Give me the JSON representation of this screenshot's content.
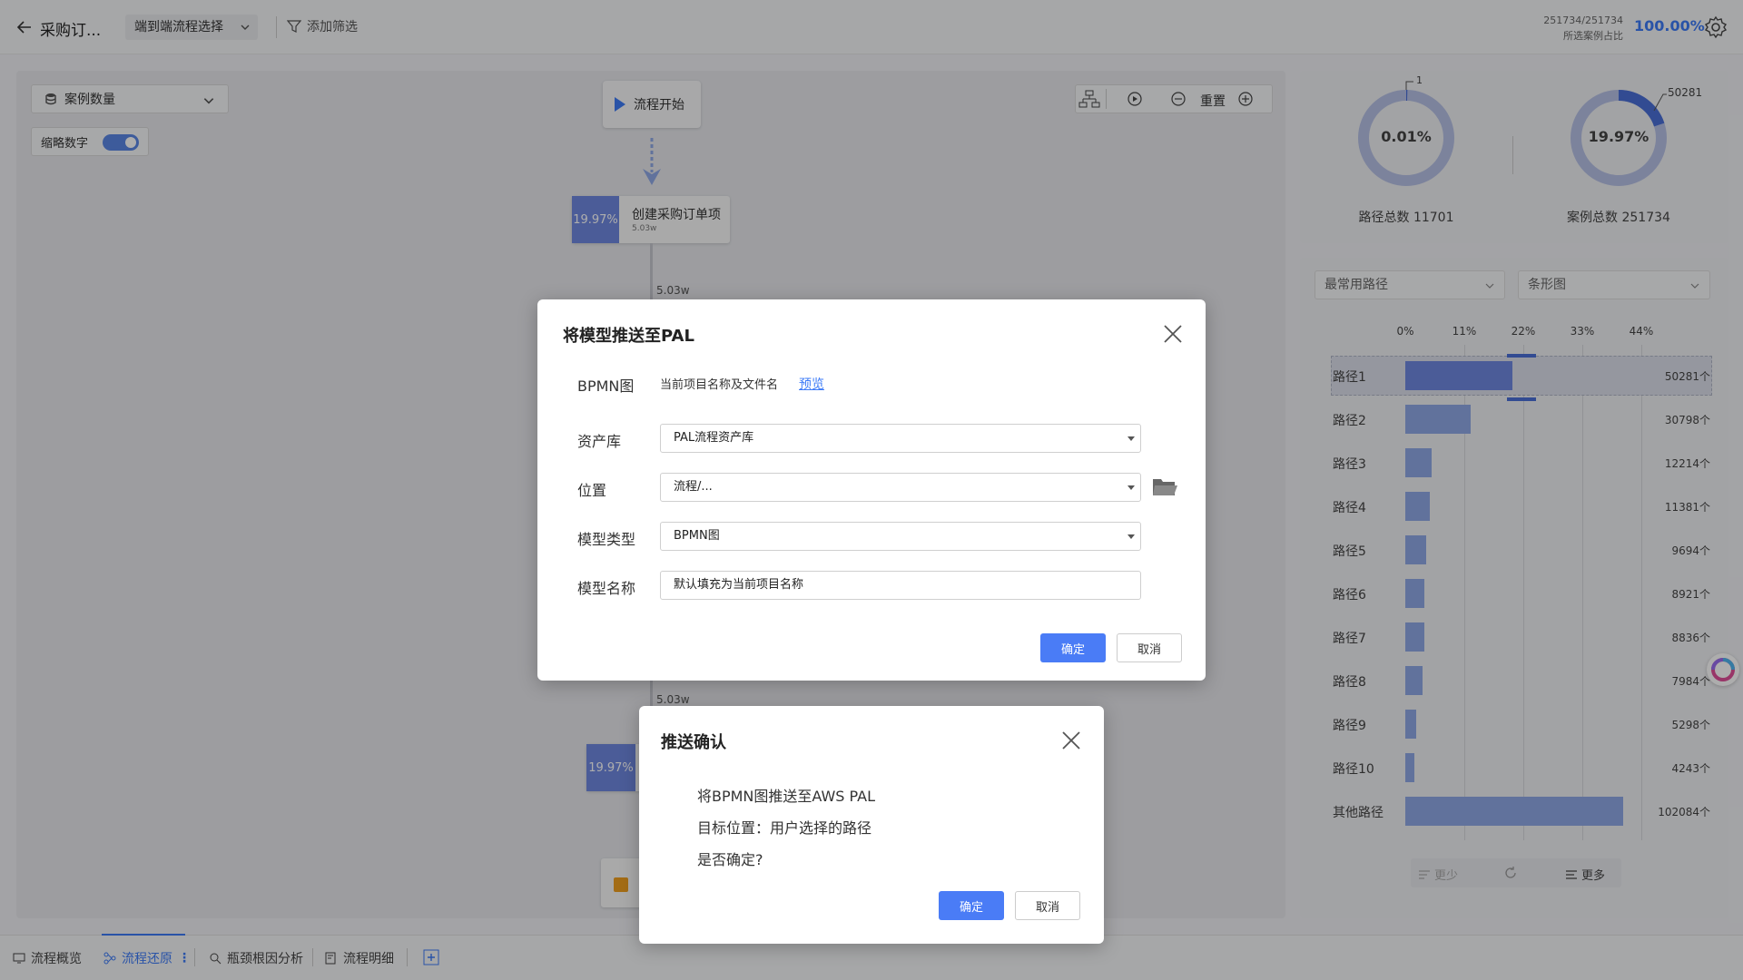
{
  "topbar": {
    "title": "采购订...",
    "flow_select": "端到端流程选择",
    "add_filter": "添加筛选",
    "ratio": "251734/251734",
    "ratio_label": "所选案例占比",
    "percent": "100.00%"
  },
  "canvas": {
    "metric_select": "案例数量",
    "abbr_label": "缩略数字",
    "abbr_on": true,
    "flow_start": "流程开始",
    "node1": {
      "percent": "19.97%",
      "label": "创建采购订单项",
      "count": "5.03w"
    },
    "edge1": "5.03w",
    "edge2": "5.03w",
    "node2": {
      "percent": "19.97%"
    },
    "reset": "重置"
  },
  "stats": {
    "path_donut": {
      "value": "0.01%",
      "callout": "1",
      "label": "路径总数 11701",
      "fraction": 0.0001
    },
    "case_donut": {
      "value": "19.97%",
      "callout": "50281",
      "label": "案例总数 251734",
      "fraction": 0.1997
    }
  },
  "path_chart": {
    "select_left": "最常用路径",
    "select_right": "条形图",
    "ticks": [
      "0%",
      "11%",
      "22%",
      "33%",
      "44%"
    ],
    "more_less": "更少",
    "more": "更多"
  },
  "chart_data": {
    "type": "bar",
    "orientation": "horizontal",
    "categories": [
      "路径1",
      "路径2",
      "路径3",
      "路径4",
      "路径5",
      "路径6",
      "路径7",
      "路径8",
      "路径9",
      "路径10",
      "其他路径"
    ],
    "values": [
      50281,
      30798,
      12214,
      11381,
      9694,
      8921,
      8836,
      7984,
      5298,
      4243,
      102084
    ],
    "value_labels": [
      "50281个",
      "30798个",
      "12214个",
      "11381个",
      "9694个",
      "8921个",
      "8836个",
      "7984个",
      "5298个",
      "4243个",
      "102084个"
    ],
    "xlabel": "",
    "ylabel": "",
    "xticks": [
      "0%",
      "11%",
      "22%",
      "33%",
      "44%"
    ],
    "highlight": "路径1",
    "colors": {
      "bar": "#8fa8e6",
      "highlight": "#6f88e0"
    }
  },
  "bottom_tabs": [
    {
      "label": "流程概览",
      "active": false
    },
    {
      "label": "流程还原",
      "active": true
    },
    {
      "label": "瓶颈根因分析",
      "active": false
    },
    {
      "label": "流程明细",
      "active": false
    }
  ],
  "push_dialog": {
    "title": "将模型推送至PAL",
    "bpmn_label": "BPMN图",
    "bpmn_value": "当前项目名称及文件名",
    "preview_link": "预览",
    "repo_label": "资产库",
    "repo_value": "PAL流程资产库",
    "location_label": "位置",
    "location_value": "流程/...",
    "type_label": "模型类型",
    "type_value": "BPMN图",
    "name_label": "模型名称",
    "name_value": "默认填充为当前项目名称",
    "confirm": "确定",
    "cancel": "取消"
  },
  "confirm_dialog": {
    "title": "推送确认",
    "line1": "将BPMN图推送至AWS PAL",
    "line2": "目标位置：用户选择的路径",
    "line3": "是否确定?",
    "confirm": "确定",
    "cancel": "取消"
  },
  "colors": {
    "accent": "#3d7bf7",
    "primary_button": "#4a7cf6",
    "bar": "#8fa8e6",
    "node": "#6f88e0"
  }
}
